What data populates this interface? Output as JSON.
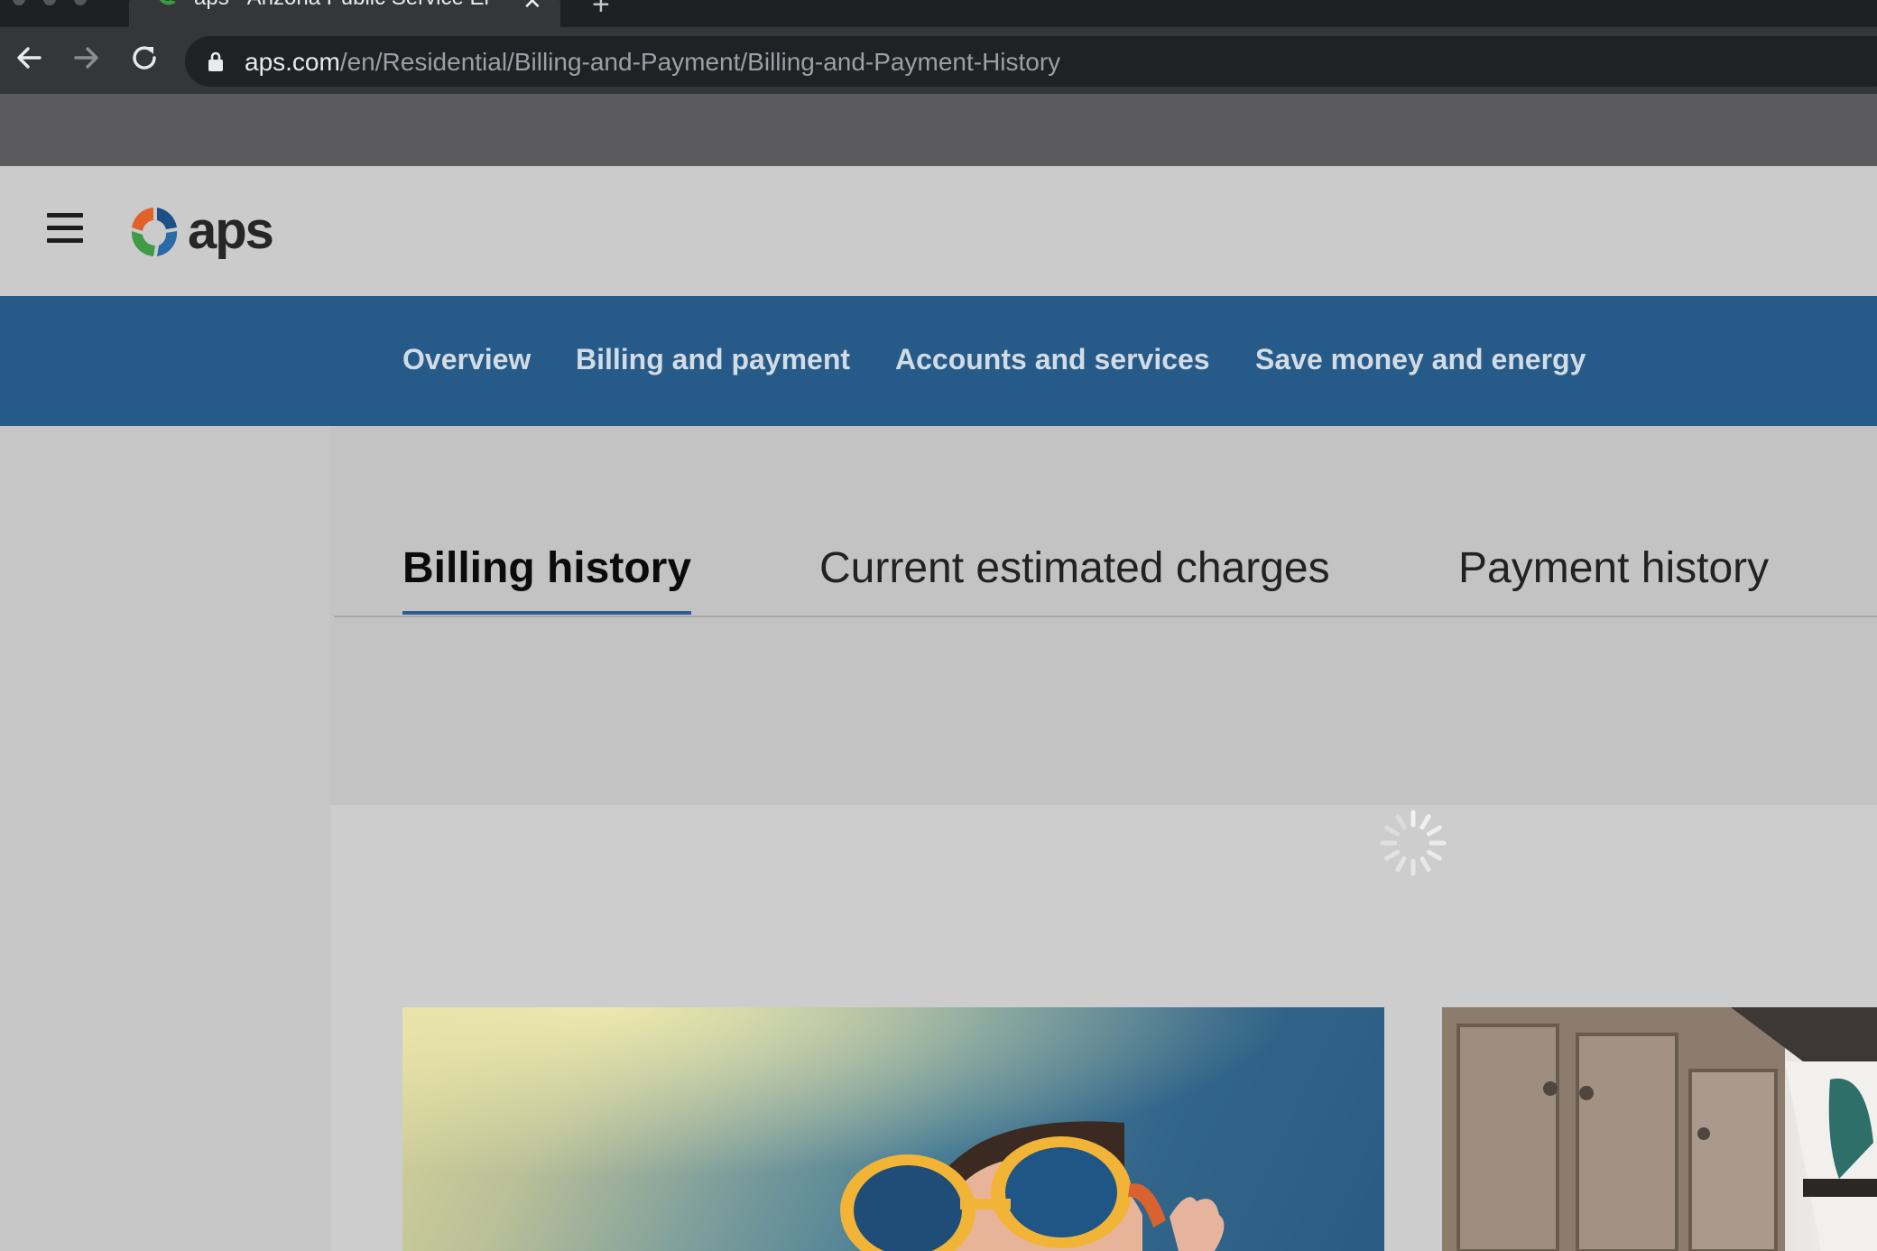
{
  "browser": {
    "tab_title": "aps - Arizona Public Service El",
    "url_host": "aps.com",
    "url_path": "/en/Residential/Billing-and-Payment/Billing-and-Payment-History"
  },
  "header": {
    "logo_text": "aps"
  },
  "nav": {
    "items": [
      "Overview",
      "Billing and payment",
      "Accounts and services",
      "Save money and energy"
    ]
  },
  "subtabs": {
    "items": [
      "Billing history",
      "Current estimated charges",
      "Payment history"
    ],
    "active": "Billing history"
  },
  "colors": {
    "nav_bg": "#265b89",
    "active_underline": "#2b5f93"
  },
  "icons": [
    "back-arrow-icon",
    "forward-arrow-icon",
    "reload-icon",
    "lock-icon",
    "hamburger-menu-icon",
    "loading-spinner-icon",
    "close-icon",
    "new-tab-icon"
  ]
}
